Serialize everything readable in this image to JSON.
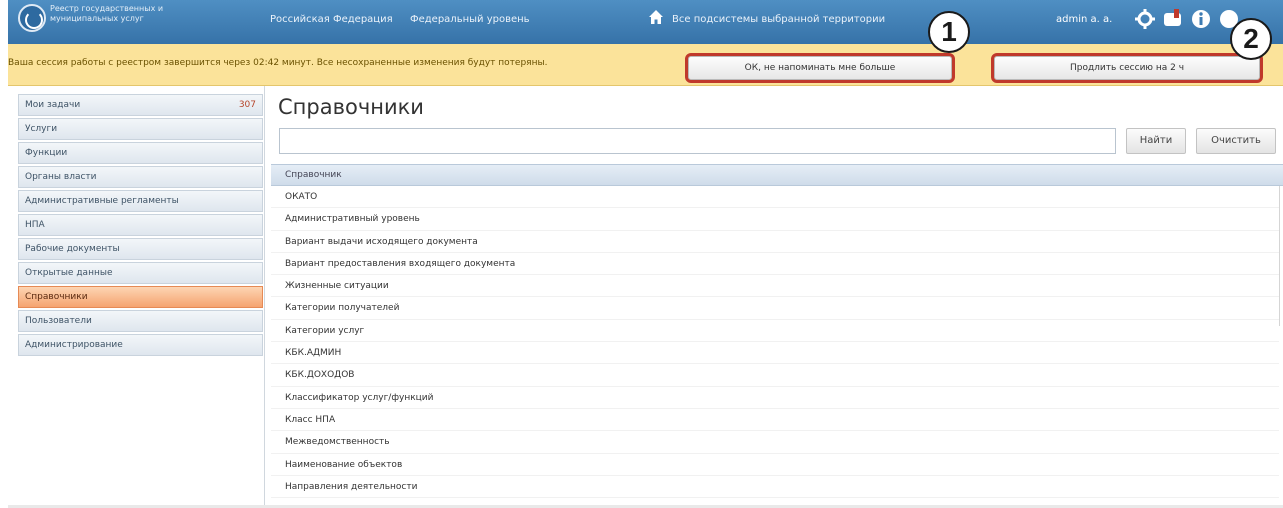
{
  "header": {
    "app_name": "Реестр государственных и муниципальных услуг",
    "links": [
      "Российская Федерация",
      "Федеральный уровень",
      "Все подсистемы выбранной территории"
    ],
    "user": "admin a. a.",
    "icons": [
      "logo-icon",
      "home-icon",
      "gear-icon",
      "notification-icon",
      "info-icon",
      "help-icon"
    ]
  },
  "session_warning": {
    "text": "Ваша сессия работы с реестром завершится через 02:42 минут. Все несохраненные изменения будут потеряны.",
    "dismiss_label": "ОК, не напоминать мне больше",
    "extend_label": "Продлить сессию на 2 ч",
    "markers": [
      "1",
      "2"
    ]
  },
  "sidebar": {
    "items": [
      {
        "label": "Мои задачи",
        "count": "307"
      },
      {
        "label": "Услуги"
      },
      {
        "label": "Функции"
      },
      {
        "label": "Органы власти"
      },
      {
        "label": "Административные регламенты"
      },
      {
        "label": "НПА"
      },
      {
        "label": "Рабочие документы"
      },
      {
        "label": "Открытые данные"
      },
      {
        "label": "Справочники",
        "active": true
      },
      {
        "label": "Пользователи"
      },
      {
        "label": "Администрирование"
      }
    ]
  },
  "main": {
    "title": "Справочники",
    "search": {
      "value": "",
      "find_label": "Найти",
      "clear_label": "Очистить"
    },
    "table": {
      "column": "Справочник",
      "rows": [
        "ОКАТО",
        "Административный уровень",
        "Вариант выдачи исходящего документа",
        "Вариант предоставления входящего документа",
        "Жизненные ситуации",
        "Категории получателей",
        "Категории услуг",
        "КБК.АДМИН",
        "КБК.ДОХОДОВ",
        "Классификатор услуг/функций",
        "Класс НПА",
        "Межведомственность",
        "Наименование объектов",
        "Направления деятельности"
      ]
    }
  },
  "colors": {
    "header": "#3d7bb2",
    "warning": "#fbe39a",
    "active_item": "#f5a370",
    "highlight": "#c0392b"
  }
}
